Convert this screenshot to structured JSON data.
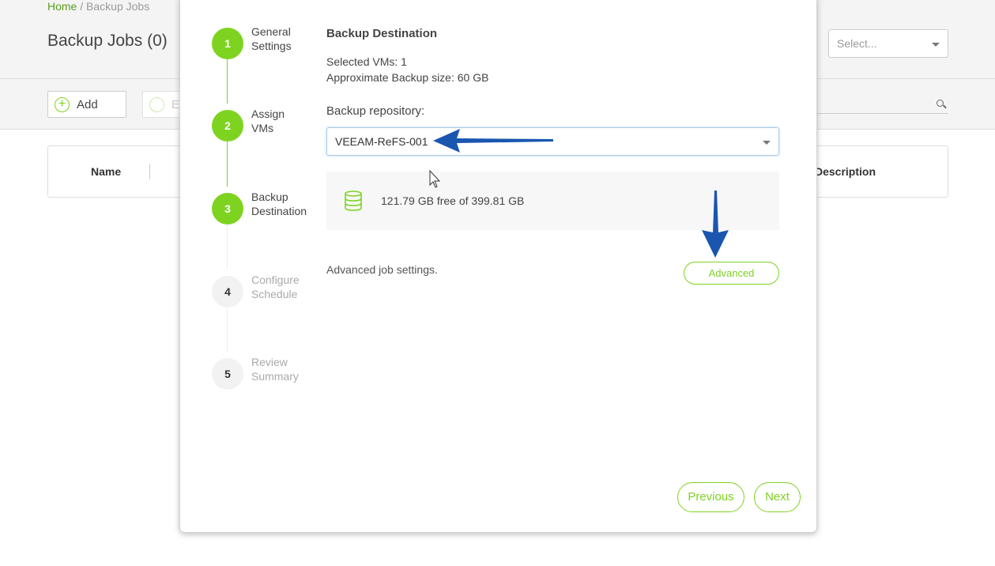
{
  "background": {
    "breadcrumb": {
      "home": "Home",
      "separator": " / ",
      "current": "Backup Jobs"
    },
    "title": "Backup Jobs (0)",
    "filter_select": {
      "placeholder": "Select..."
    },
    "toolbar": {
      "add_label": "Add",
      "edit_label": "E"
    },
    "table": {
      "columns": [
        "Name",
        "Description"
      ]
    }
  },
  "wizard": {
    "steps": [
      {
        "number": "1",
        "label_line1": "General",
        "label_line2": "Settings",
        "state": "done"
      },
      {
        "number": "2",
        "label_line1": "Assign",
        "label_line2": "VMs",
        "state": "done"
      },
      {
        "number": "3",
        "label_line1": "Backup",
        "label_line2": "Destination",
        "state": "current"
      },
      {
        "number": "4",
        "label_line1": "Configure",
        "label_line2": "Schedule",
        "state": "pending"
      },
      {
        "number": "5",
        "label_line1": "Review",
        "label_line2": "Summary",
        "state": "pending"
      }
    ],
    "section_title": "Backup Destination",
    "selected_vms": "Selected VMs: 1",
    "approx_size": "Approximate Backup size: 60 GB",
    "repository_label": "Backup repository:",
    "repository_value": "VEEAM-ReFS-001",
    "storage_text": "121.79 GB free of 399.81 GB",
    "storage_icon": "database-icon",
    "advanced_text": "Advanced job settings.",
    "advanced_button": "Advanced",
    "previous_button": "Previous",
    "next_button": "Next"
  },
  "colors": {
    "accent_green": "#7ed321",
    "annotation_arrow": "#1a56b0"
  }
}
